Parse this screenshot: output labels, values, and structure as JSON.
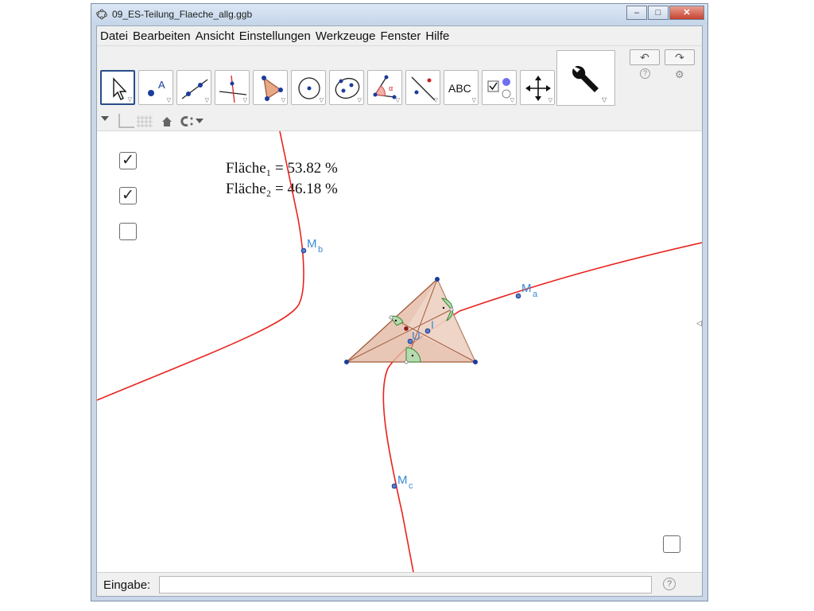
{
  "window": {
    "title": "09_ES-Teilung_Flaeche_allg.ggb",
    "minimize": "–",
    "maximize": "□",
    "close": "✕"
  },
  "menu": [
    "Datei",
    "Bearbeiten",
    "Ansicht",
    "Einstellungen",
    "Werkzeuge",
    "Fenster",
    "Hilfe"
  ],
  "toolbar": {
    "tools": [
      "move-tool",
      "point-tool",
      "line-tool",
      "perpendicular-line-tool",
      "polygon-tool",
      "circle-tool",
      "conic-tool",
      "angle-tool",
      "reflect-tool",
      "text-tool",
      "checkbox-tool",
      "move-graphics-view-tool"
    ],
    "point_label": "A",
    "text_tool_label": "ABC",
    "angle_label": "α",
    "undo": "↶",
    "redo": "↷",
    "help": "?",
    "settings": "⚙"
  },
  "canvas": {
    "checkboxes": [
      {
        "checked": true,
        "mark": "✓"
      },
      {
        "checked": true,
        "mark": "✓"
      },
      {
        "checked": false,
        "mark": ""
      },
      {
        "checked": false,
        "mark": ""
      }
    ],
    "area_lines": [
      "Fläche₁ = 53.82 %",
      "Fläche₂ = 46.18 %"
    ],
    "point_labels": {
      "Mb": {
        "main": "M",
        "sub": "b"
      },
      "Ma": {
        "main": "M",
        "sub": "a"
      },
      "Mc": {
        "main": "M",
        "sub": "c"
      },
      "U": "U",
      "I": "I"
    },
    "colors": {
      "hyperbola": "#e8231d",
      "triangle_fill": "#e3b9a5",
      "triangle_stroke": "#a05a3a",
      "point": "#1a3c9c",
      "label": "#3a8ad6",
      "angle_fill": "#b8d9b2",
      "angle_stroke": "#2f8a2f"
    }
  },
  "input": {
    "label": "Eingabe:",
    "value": "",
    "help": "?"
  }
}
